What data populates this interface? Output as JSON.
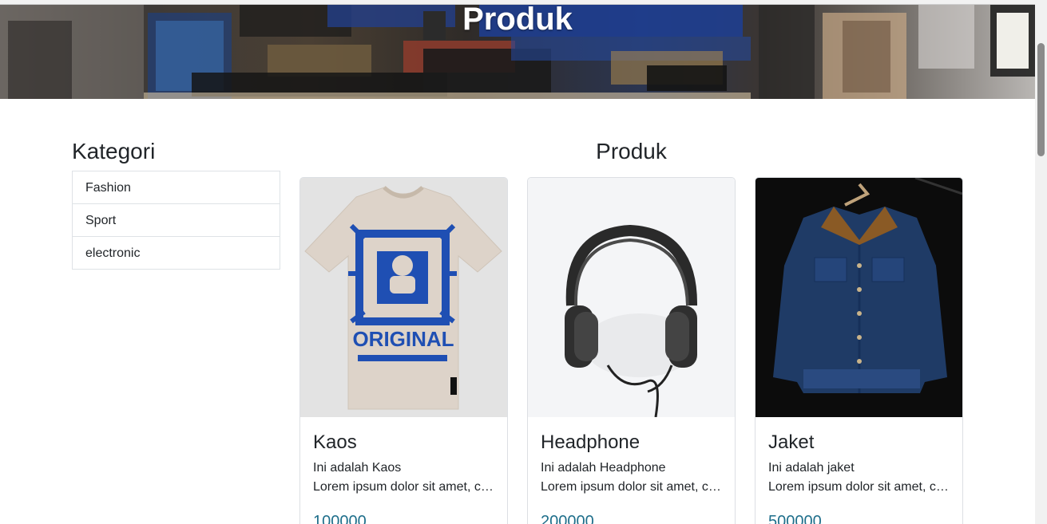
{
  "hero": {
    "title": "Produk"
  },
  "sidebar": {
    "title": "Kategori",
    "items": [
      {
        "label": "Fashion"
      },
      {
        "label": "Sport"
      },
      {
        "label": "electronic"
      }
    ]
  },
  "main": {
    "title": "Produk",
    "products": [
      {
        "name": "Kaos",
        "description": "Ini adalah Kaos",
        "text": "Lorem ipsum dolor sit amet, consectetur adipisicing elit.",
        "price": "100000",
        "image_icon": "t-shirt-image"
      },
      {
        "name": "Headphone",
        "description": "Ini adalah Headphone",
        "text": "Lorem ipsum dolor sit amet, consectetur adipisicing elit.",
        "price": "200000",
        "image_icon": "headphone-image"
      },
      {
        "name": "Jaket",
        "description": "Ini adalah jaket",
        "text": "Lorem ipsum dolor sit amet, consectetur adipisicing elit.",
        "price": "500000",
        "image_icon": "jacket-image"
      }
    ]
  },
  "colors": {
    "price": "#1f6f8b",
    "hero_overlay": "#3e3a37"
  },
  "tshirt_print": {
    "text": "ORIGINAL"
  }
}
